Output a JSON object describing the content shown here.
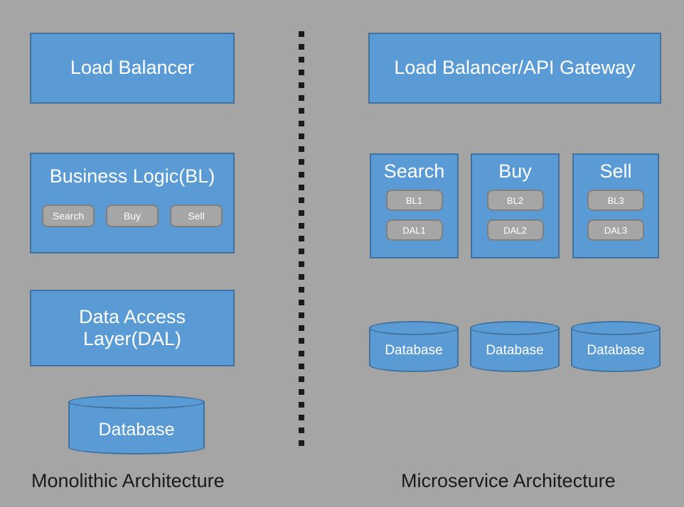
{
  "colors": {
    "background": "#a5a5a5",
    "node_fill": "#5b9bd5",
    "node_border": "#41719c",
    "chip_fill": "#a6a6a6",
    "chip_border": "#7f7f7f",
    "node_text": "#ffffff",
    "caption_text": "#1a1a1a",
    "divider": "#1a1a1a"
  },
  "monolith": {
    "caption": "Monolithic Architecture",
    "load_balancer": "Load Balancer",
    "business_logic": {
      "title": "Business Logic(BL)",
      "modules": [
        {
          "label": "Search"
        },
        {
          "label": "Buy"
        },
        {
          "label": "Sell"
        }
      ]
    },
    "data_access_layer": "Data Access\nLayer(DAL)",
    "data_access_layer_line1": "Data Access",
    "data_access_layer_line2": "Layer(DAL)",
    "database": "Database"
  },
  "microservice": {
    "caption": "Microservice Architecture",
    "load_balancer": "Load Balancer/API Gateway",
    "services": [
      {
        "title": "Search",
        "business_logic": "BL1",
        "data_access_layer": "DAL1"
      },
      {
        "title": "Buy",
        "business_logic": "BL2",
        "data_access_layer": "DAL2"
      },
      {
        "title": "Sell",
        "business_logic": "BL3",
        "data_access_layer": "DAL3"
      }
    ],
    "databases": [
      {
        "label": "Database"
      },
      {
        "label": "Database"
      },
      {
        "label": "Database"
      }
    ]
  }
}
